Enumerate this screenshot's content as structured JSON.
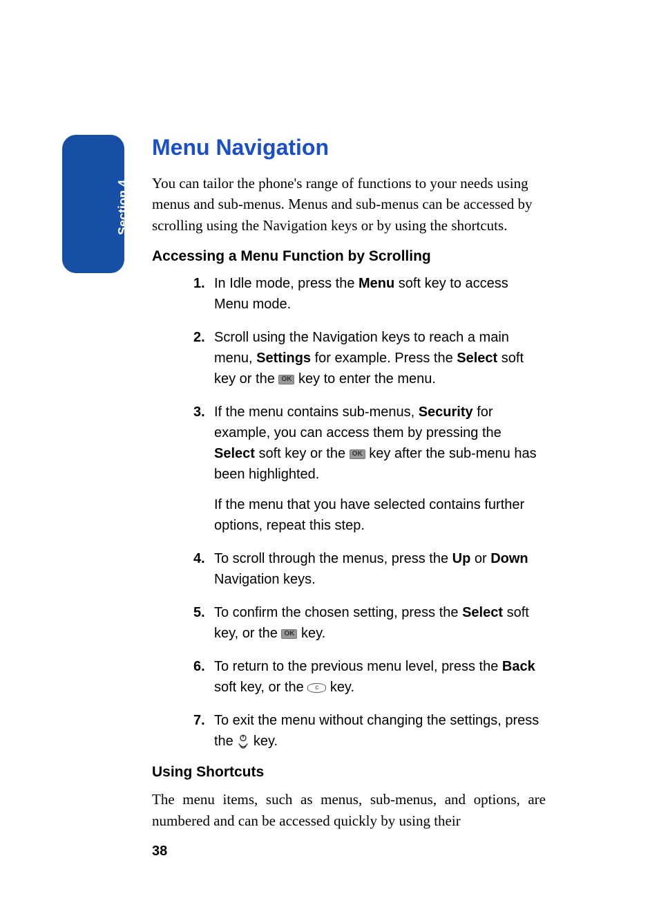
{
  "section_tab": "Section 4",
  "heading": "Menu Navigation",
  "intro": "You can tailor the phone's range of functions to your needs using menus and sub-menus. Menus and sub-menus can be accessed by scrolling using the Navigation keys or by using the shortcuts.",
  "sub1": "Accessing a Menu Function by Scrolling",
  "steps": {
    "s1a": "In Idle mode, press the ",
    "s1b": "Menu",
    "s1c": " soft key to access Menu mode.",
    "s2a": "Scroll using the Navigation keys to reach a main menu, ",
    "s2b": "Settings",
    "s2c": " for example. Press the ",
    "s2d": "Select",
    "s2e": " soft key or the ",
    "s2f": " key to enter the menu.",
    "s3a": "If the menu contains sub-menus, ",
    "s3b": "Security",
    "s3c": " for example, you can access them by pressing the ",
    "s3d": "Select",
    "s3e": " soft key or the ",
    "s3f": " key after the sub-menu has been highlighted.",
    "s3g": "If the menu that you have selected contains further options, repeat this step.",
    "s4a": "To scroll through the menus, press the ",
    "s4b": "Up",
    "s4c": " or ",
    "s4d": "Down",
    "s4e": " Navigation keys.",
    "s5a": "To confirm the chosen setting, press the ",
    "s5b": "Select",
    "s5c": " soft key, or the ",
    "s5d": " key.",
    "s6a": "To return to the previous menu level, press the ",
    "s6b": "Back",
    "s6c": " soft key, or the ",
    "s6d": "key.",
    "s7a": "To exit the menu without changing the settings, press the ",
    "s7b": "key."
  },
  "sub2": "Using Shortcuts",
  "shortcuts_para": "The menu items, such as menus, sub-menus, and options, are numbered and can be accessed quickly by using their",
  "page_number": "38",
  "ok_label": "OK",
  "c_label": "c"
}
